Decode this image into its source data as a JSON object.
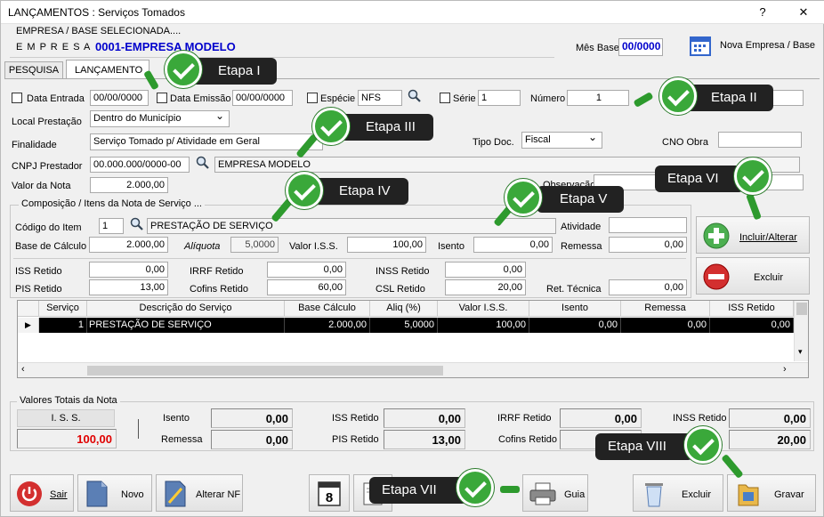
{
  "window": {
    "title": "LANÇAMENTOS : Serviços Tomados",
    "help_label": "?",
    "close_label": "✕"
  },
  "header": {
    "empresa_base_label": "EMPRESA  /  BASE  SELECIONADA....",
    "empresa_label": "E  M  P  R  E  S  A",
    "empresa_value": "0001-EMPRESA MODELO",
    "mes_base_label": "Mês Base",
    "mes_base_value": "00/0000",
    "nova_empresa_label": "Nova Empresa / Base"
  },
  "tabs": [
    {
      "label": "PESQUISA"
    },
    {
      "label": "LANÇAMENTO"
    }
  ],
  "form": {
    "data_entrada_label": "Data Entrada",
    "data_entrada_value": "00/00/0000",
    "data_emissao_label": "Data Emissão",
    "data_emissao_value": "00/00/0000",
    "especie_label": "Espécie",
    "especie_value": "NFS",
    "serie_label": "Série",
    "serie_value": "1",
    "numero_label": "Número",
    "numero_value": "1",
    "local_prestacao_label": "Local Prestação",
    "local_prestacao_value": "Dentro do Município",
    "finalidade_label": "Finalidade",
    "finalidade_value": "Serviço Tomado p/ Atividade em Geral",
    "tipo_doc_label": "Tipo Doc.",
    "tipo_doc_value": "Fiscal",
    "cno_obra_label": "CNO Obra",
    "cnpj_label": "CNPJ Prestador",
    "cnpj_value": "00.000.000/0000-00",
    "prestador_name": "EMPRESA MODELO",
    "valor_nota_label": "Valor da Nota",
    "valor_nota_value": "2.000,00",
    "observacao_label": "Observação"
  },
  "composicao": {
    "title": "Composição / Itens da Nota de Serviço ...",
    "codigo_item_label": "Código do Item",
    "codigo_item_value": "1",
    "item_desc": "PRESTAÇÃO DE SERVIÇO",
    "atividade_label": "Atividade",
    "base_calculo_label": "Base de Cálculo",
    "base_calculo_value": "2.000,00",
    "aliquota_label": "Alíquota",
    "aliquota_value": "5,0000",
    "valor_iss_label": "Valor  I.S.S.",
    "valor_iss_value": "100,00",
    "isento_label": "Isento",
    "isento_value": "0,00",
    "remessa_label": "Remessa",
    "remessa_value": "0,00",
    "iss_retido_label": "ISS Retido",
    "iss_retido_value": "0,00",
    "irrf_retido_label": "IRRF Retido",
    "irrf_retido_value": "0,00",
    "inss_retido_label": "INSS Retido",
    "inss_retido_value": "0,00",
    "pis_retido_label": "PIS Retido",
    "pis_retido_value": "13,00",
    "cofins_retido_label": "Cofins Retido",
    "cofins_retido_value": "60,00",
    "csl_retido_label": "CSL Retido",
    "csl_retido_value": "20,00",
    "ret_tecnica_label": "Ret. Técnica",
    "ret_tecnica_value": "0,00",
    "incluir_label": "Incluir/Alterar",
    "excluir_label": "Excluir"
  },
  "grid": {
    "columns": [
      "Serviço",
      "Descrição do Serviço",
      "Base Cálculo",
      "Aliq (%)",
      "Valor I.S.S.",
      "Isento",
      "Remessa",
      "ISS Retido"
    ],
    "rows": [
      {
        "servico": "1",
        "descricao": "PRESTAÇÃO DE SERVIÇO",
        "base": "2.000,00",
        "aliq": "5,0000",
        "valor_iss": "100,00",
        "isento": "0,00",
        "remessa": "0,00",
        "iss_retido": "0,00"
      }
    ]
  },
  "totais": {
    "title": "Valores Totais da Nota",
    "iss_label": "I. S. S.",
    "iss_value": "100,00",
    "isento_label": "Isento",
    "isento_value": "0,00",
    "remessa_label": "Remessa",
    "remessa_value": "0,00",
    "iss_retido_label": "ISS Retido",
    "iss_retido_value": "0,00",
    "pis_retido_label": "PIS Retido",
    "pis_retido_value": "13,00",
    "irrf_retido_label": "IRRF Retido",
    "irrf_retido_value": "0,00",
    "cofins_retido_label": "Cofins Retido",
    "inss_retido_label": "INSS Retido",
    "inss_retido_value": "0,00",
    "csl_value": "20,00"
  },
  "toolbar": {
    "sair_label": "Sair",
    "novo_label": "Novo",
    "alterar_label": "Alterar NF",
    "calendar_day": "8",
    "guia_label": "Guia",
    "excluir_label": "Excluir",
    "gravar_label": "Gravar"
  },
  "etapas": [
    "Etapa I",
    "Etapa II",
    "Etapa III",
    "Etapa IV",
    "Etapa V",
    "Etapa VI",
    "Etapa VII",
    "Etapa VIII"
  ],
  "colors": {
    "accent_blue": "#0000cc",
    "iss_red": "#e00000",
    "badge_bg": "#222222",
    "check_green": "#3aa83a"
  }
}
